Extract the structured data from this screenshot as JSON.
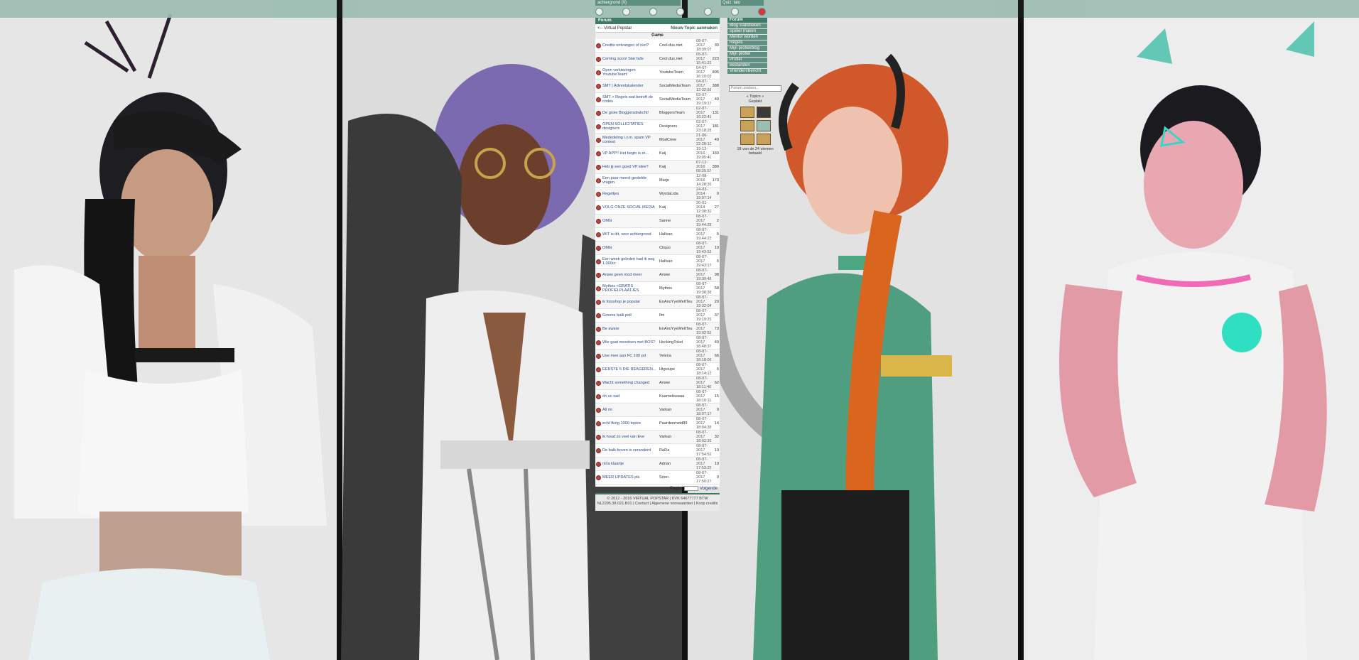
{
  "topbar": {
    "user_label": "achtergrond (0)",
    "user_label2": "Quiz: lalo"
  },
  "forum": {
    "header": "Forum",
    "breadcrumb": "<-- Virtual Popstar",
    "new_topic": "Nieuw Topic aanmaken",
    "category": "Game",
    "topics": [
      {
        "title": "Credits ontvangen of niet?",
        "author": "Cool.dus.niet",
        "date": "08-07-2017 18:39:07",
        "count": "39"
      },
      {
        "title": "Coming soon! Star falls",
        "author": "Cool.dus.niet",
        "date": "05-07-2017 15:41:29",
        "count": "223"
      },
      {
        "title": "Open verkiezingen YoutubeTeam!",
        "author": "YoutubeTeam",
        "date": "04-07-2017 16:10:03",
        "count": "805"
      },
      {
        "title": "SMT | Adventskalender",
        "author": "SocialMediaTeam",
        "date": "04-07-2017 12:32:56",
        "count": "388"
      },
      {
        "title": "SMT > Regels wat betreft de codes",
        "author": "SocialMediaTeam",
        "date": "03-07-2017 19:19:17",
        "count": "40"
      },
      {
        "title": "De grote Bloggersdrukcht!",
        "author": "BloggersTeam",
        "date": "02-07-2017 16:22:42",
        "count": "131"
      },
      {
        "title": "OPEN SOLLICITATIES designers",
        "author": "Designers",
        "date": "02-07-2017 23:18:28",
        "count": "181"
      },
      {
        "title": "Mededeling i.v.m. spam VP contest",
        "author": "ModCrew",
        "date": "21-06-2017 22:28:10",
        "count": "40"
      },
      {
        "title": "VP APP!! Het begin is er...",
        "author": "Kaij",
        "date": "19-12-2016 19:05:40",
        "count": "169"
      },
      {
        "title": "Heb jij een goed VP idee?",
        "author": "Kaij",
        "date": "07-12-2016 08:25:57",
        "count": "389"
      },
      {
        "title": "Een paar meest gestelde vragen.",
        "author": "Marje",
        "date": "12-08-2016 14:28:39",
        "count": "170"
      },
      {
        "title": "Regeltjes",
        "author": "WyrdaLida",
        "date": "24-03-2014 19:07:14",
        "count": "0"
      },
      {
        "title": "VOLG ONZE SOCIAL MEDIA",
        "author": "Kaij",
        "date": "20-01-2014 12:38:32",
        "count": "27"
      },
      {
        "title": "OMG",
        "author": "Sanne",
        "date": "08-07-2017 19:44:28",
        "count": "2"
      },
      {
        "title": "WIT is dit, voor achtergrond",
        "author": "Hallvan",
        "date": "08-07-2017 19:44:23",
        "count": "5"
      },
      {
        "title": "OMG",
        "author": "Cliquo",
        "date": "08-07-2017 19:43:52",
        "count": "10"
      },
      {
        "title": "Een week geleden had ik nog 1.000cr",
        "author": "Hallvan",
        "date": "08-07-2017 19:43:17",
        "count": "6"
      },
      {
        "title": "Anww geen mod meer",
        "author": "Anww",
        "date": "08-07-2017 19:39:48",
        "count": "98"
      },
      {
        "title": "Mythos <GRATIS PROFIELPLAATJES",
        "author": "Mythos",
        "date": "08-07-2017 19:38:38",
        "count": "58"
      },
      {
        "title": "ik fotoshop je popstar",
        "author": "EnAnoYyeWeltTeu",
        "date": "08-07-2017 19:32:04",
        "count": "20"
      },
      {
        "title": "Groene balk poll",
        "author": "Ilm",
        "date": "08-07-2017 19:19:29",
        "count": "37"
      },
      {
        "title": "Be aware",
        "author": "EnAnoYyeWeltTeu",
        "date": "08-07-2017 19:02:52",
        "count": "73"
      },
      {
        "title": "Wie gaat meedoen met BOS?",
        "author": "HockingTokel",
        "date": "08-07-2017 18:48:37",
        "count": "40"
      },
      {
        "title": "Use mee aan FC 100 pd",
        "author": "Yelena",
        "date": "08-07-2017 18:18:06",
        "count": "66"
      },
      {
        "title": "EERSTE 5 DIE REAGEREN...",
        "author": "Htgviups",
        "date": "08-07-2017 18:14:13",
        "count": "6"
      },
      {
        "title": "Wacht something changed",
        "author": "Anww",
        "date": "08-07-2017 18:11:40",
        "count": "62"
      },
      {
        "title": "oh so sad",
        "author": "Kuamelissaaa",
        "date": "08-07-2017 18:10:11",
        "count": "15"
      },
      {
        "title": "All rio",
        "author": "Varkan",
        "date": "08-07-2017 18:07:17",
        "count": "9"
      },
      {
        "title": "echt fking 1000 topics",
        "author": "Paardenmeid89",
        "date": "08-07-2017 18:04:38",
        "count": "14"
      },
      {
        "title": "ik houd zo veel van Eve",
        "author": "Varkan",
        "date": "08-07-2017 18:02:39",
        "count": "32"
      },
      {
        "title": "De balk boven is veranderd",
        "author": "RaRa",
        "date": "08-07-2017 17:54:52",
        "count": "10"
      },
      {
        "title": "nina klaartje",
        "author": "Adrian",
        "date": "08-07-2017 17:53:25",
        "count": "10"
      },
      {
        "title": "MEER UPDATES pls",
        "author": "Siren",
        "date": "08-07-2017 17:50:27",
        "count": "0"
      }
    ],
    "pager_label": "Pagina",
    "pager_next": "Volgende",
    "footer_line1": "© 2012 - 2016 VIRTUAL POPSTAR | KVK 64677777 BTW NL2295.38.021.B01 | Contact | Algemene voorwaarden | Koop credits"
  },
  "sidebar": {
    "items": [
      {
        "label": "Forum",
        "header": true
      },
      {
        "label": "Blog statistieken"
      },
      {
        "label": "Speler maken"
      },
      {
        "label": "Mentor worden"
      },
      {
        "label": "Regels"
      },
      {
        "label": "Mijn profiel/blog"
      },
      {
        "label": "Mijn profiel"
      },
      {
        "label": "Profiel"
      },
      {
        "label": "Bestanden"
      },
      {
        "label": "Vrienden/Bericht"
      }
    ],
    "search_placeholder": "Forum zoeken...",
    "topics_label": "« Topics »",
    "topics_sub": "Geplakt",
    "count_label": "18 van de 24 stemen betaald"
  },
  "colors": {
    "accent": "#3e7a68",
    "bar": "#9cbdb1",
    "link": "#2a4a8a"
  }
}
